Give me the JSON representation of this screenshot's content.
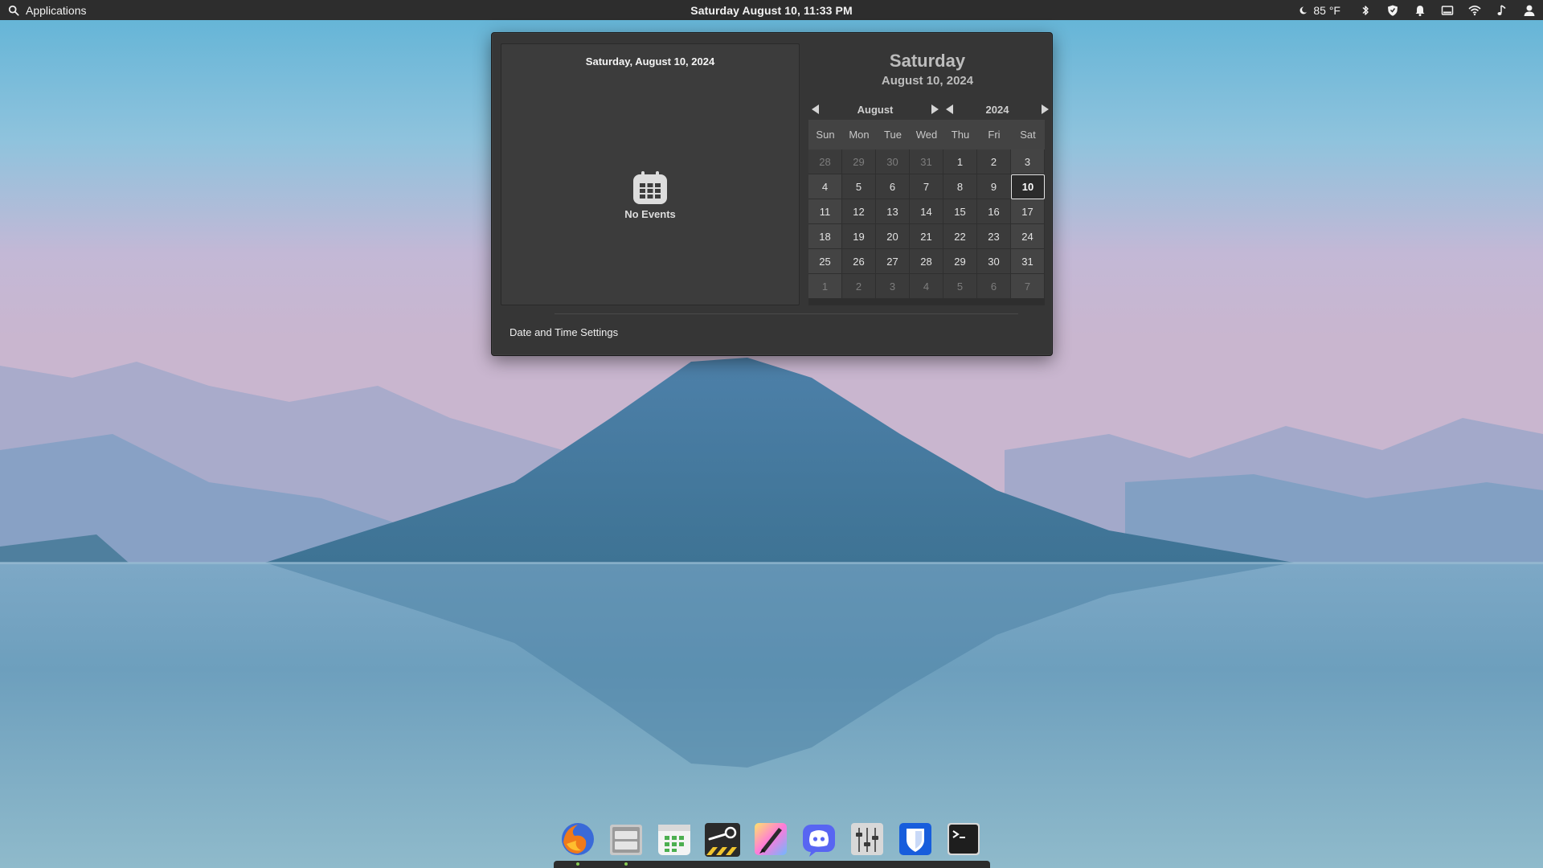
{
  "panel": {
    "applications_label": "Applications",
    "clock": "Saturday August 10, 11:33 PM",
    "weather": "85 °F"
  },
  "popover": {
    "events_date": "Saturday, August 10, 2024",
    "no_events": "No Events",
    "heading_day": "Saturday",
    "heading_date": "August 10, 2024",
    "month_label": "August",
    "year_label": "2024",
    "weekdays": [
      "Sun",
      "Mon",
      "Tue",
      "Wed",
      "Thu",
      "Fri",
      "Sat"
    ],
    "days": [
      "28",
      "29",
      "30",
      "31",
      "1",
      "2",
      "3",
      "4",
      "5",
      "6",
      "7",
      "8",
      "9",
      "10",
      "11",
      "12",
      "13",
      "14",
      "15",
      "16",
      "17",
      "18",
      "19",
      "20",
      "21",
      "22",
      "23",
      "24",
      "25",
      "26",
      "27",
      "28",
      "29",
      "30",
      "31",
      "1",
      "2",
      "3",
      "4",
      "5",
      "6",
      "7"
    ],
    "settings_label": "Date and Time Settings"
  },
  "dock": {
    "apps": [
      "firefox-icon",
      "files-icon",
      "calendar-icon",
      "steam-icon",
      "krita-icon",
      "discord-icon",
      "mixer-icon",
      "bitwarden-icon",
      "terminal-icon"
    ]
  }
}
